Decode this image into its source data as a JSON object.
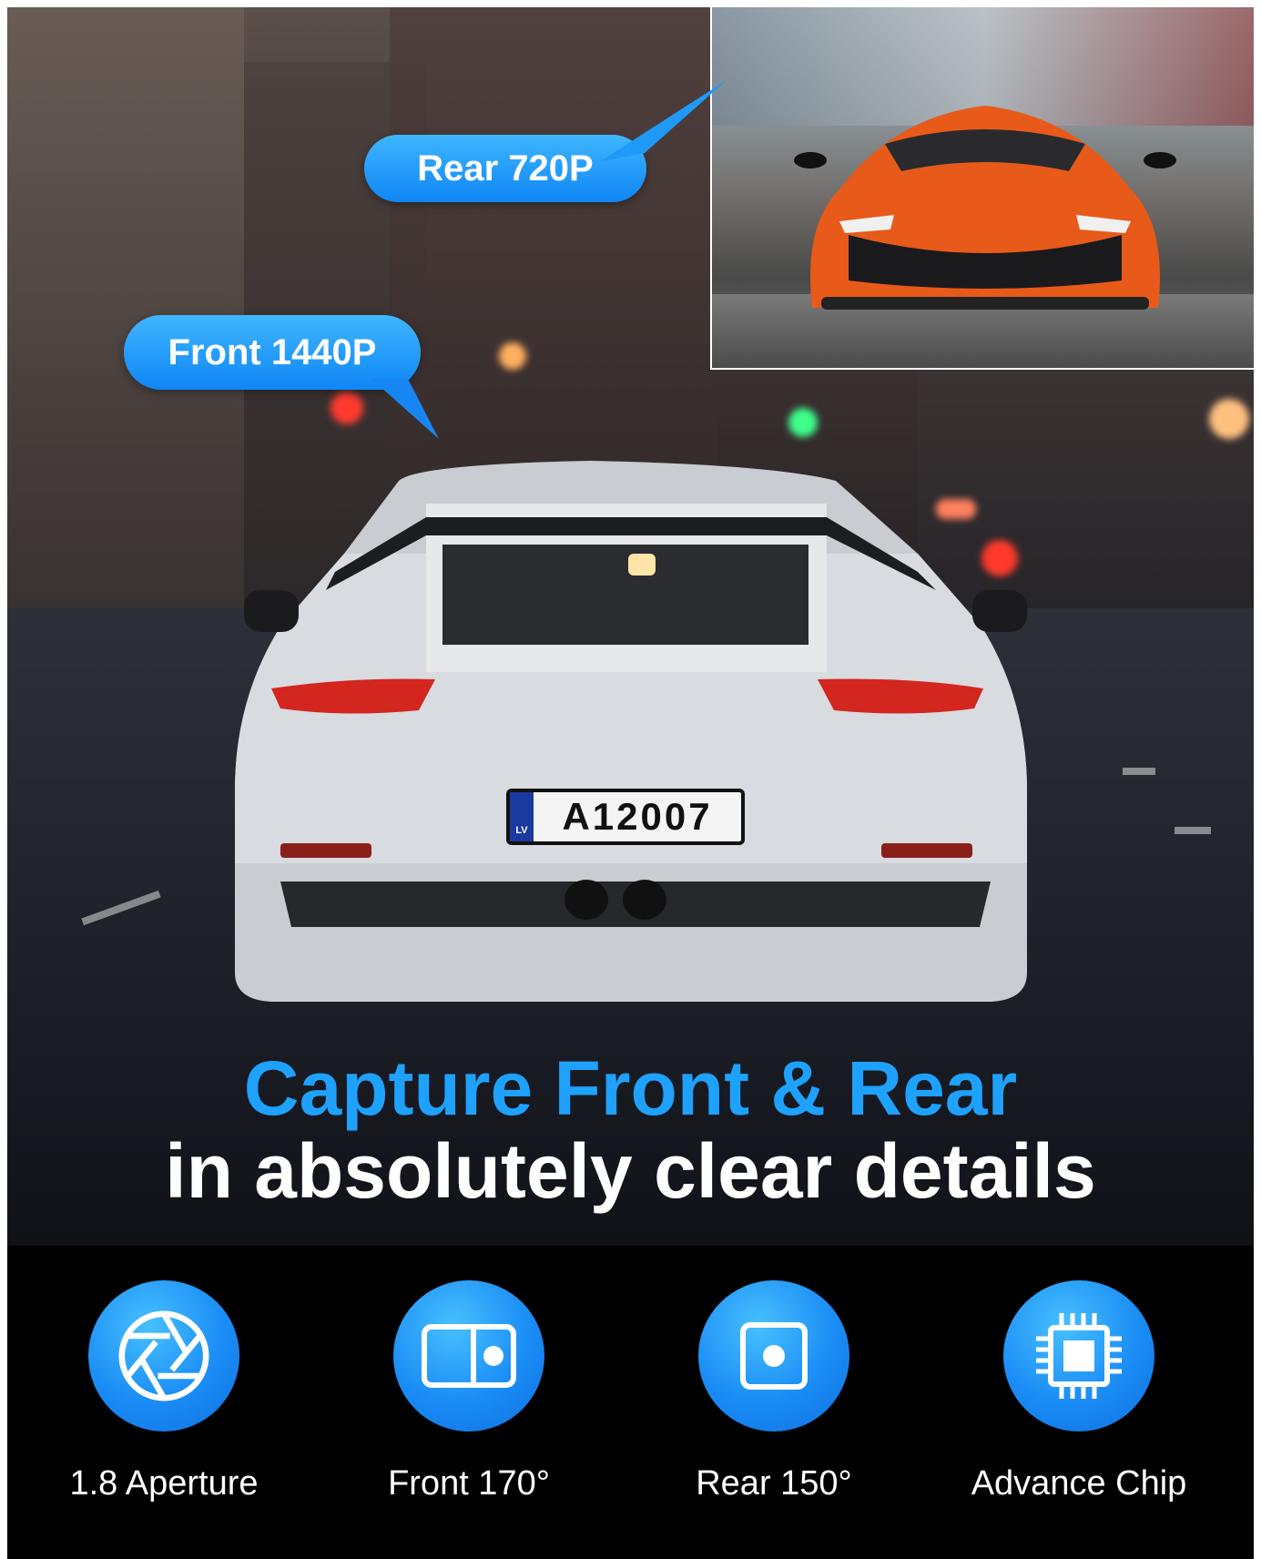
{
  "callouts": {
    "rear": "Rear 720P",
    "front": "Front 1440P"
  },
  "plate": {
    "country": "LV",
    "number": "A12007"
  },
  "headline": {
    "line1": "Capture Front & Rear",
    "line2": "in absolutely clear details"
  },
  "features": [
    {
      "icon": "aperture-icon",
      "label": "1.8 Aperture"
    },
    {
      "icon": "front-camera-icon",
      "label": "Front 170°"
    },
    {
      "icon": "rear-camera-icon",
      "label": "Rear 150°"
    },
    {
      "icon": "chip-icon",
      "label": "Advance Chip"
    }
  ],
  "colors": {
    "accent_blue": "#1ea1ff",
    "bubble_blue": "#0f86f5",
    "background": "#000000",
    "text": "#ffffff"
  }
}
